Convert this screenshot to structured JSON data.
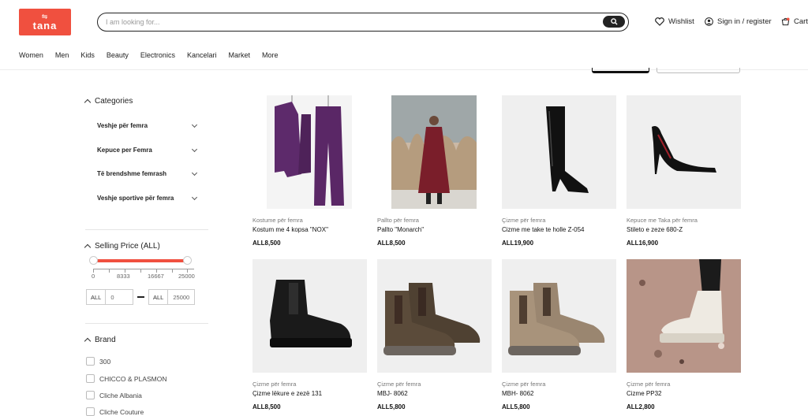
{
  "header": {
    "logo_text": "tana",
    "search_placeholder": "I am looking for...",
    "wishlist": "Wishlist",
    "signin": "Sign in / register",
    "cart": "Cart",
    "accent_color": "#f0503f"
  },
  "nav": [
    "Women",
    "Men",
    "Kids",
    "Beauty",
    "Electronics",
    "Kancelari",
    "Market",
    "More"
  ],
  "sidebar": {
    "categories_title": "Categories",
    "categories": [
      "Veshje për femra",
      "Kepuce per Femra",
      "Të brendshme femrash",
      "Veshje sportive për femra"
    ],
    "price_title": "Selling Price (ALL)",
    "price_ticks": [
      "0",
      "8333",
      "16667",
      "25000"
    ],
    "price_min": "0",
    "price_max": "25000",
    "currency": "ALL",
    "brand_title": "Brand",
    "brands": [
      "300",
      "CHICCO & PLASMON",
      "Cliche Albania",
      "Cliche Couture"
    ]
  },
  "products": [
    {
      "category": "Kostume për femra",
      "name": "Kostum me 4 kopsa \"NOX\"",
      "price": "ALL8,500",
      "icon": "purple-suit-image"
    },
    {
      "category": "Pallto për femra",
      "name": "Pallto \"Monarch\"",
      "price": "ALL8,500",
      "icon": "burgundy-coat-image"
    },
    {
      "category": "Çizme për femra",
      "name": "Cizme me take te holle Z-054",
      "price": "ALL19,900",
      "icon": "black-boot-image"
    },
    {
      "category": "Kepuce me Taka për femra",
      "name": "Stileto e zeze 680-Z",
      "price": "ALL16,900",
      "icon": "black-stiletto-image"
    },
    {
      "category": "Çizme për femra",
      "name": "Çizme lëkure e zezë 131",
      "price": "ALL8,500",
      "icon": "black-chelsea-boot-image"
    },
    {
      "category": "Çizme për femra",
      "name": "MBJ- 8062",
      "price": "ALL5,800",
      "icon": "brown-chelsea-boots-image"
    },
    {
      "category": "Çizme për femra",
      "name": "MBH- 8062",
      "price": "ALL5,800",
      "icon": "beige-chelsea-boots-image"
    },
    {
      "category": "Çizme për femra",
      "name": "Cizme PP32",
      "price": "ALL2,800",
      "icon": "cream-boot-image"
    }
  ]
}
